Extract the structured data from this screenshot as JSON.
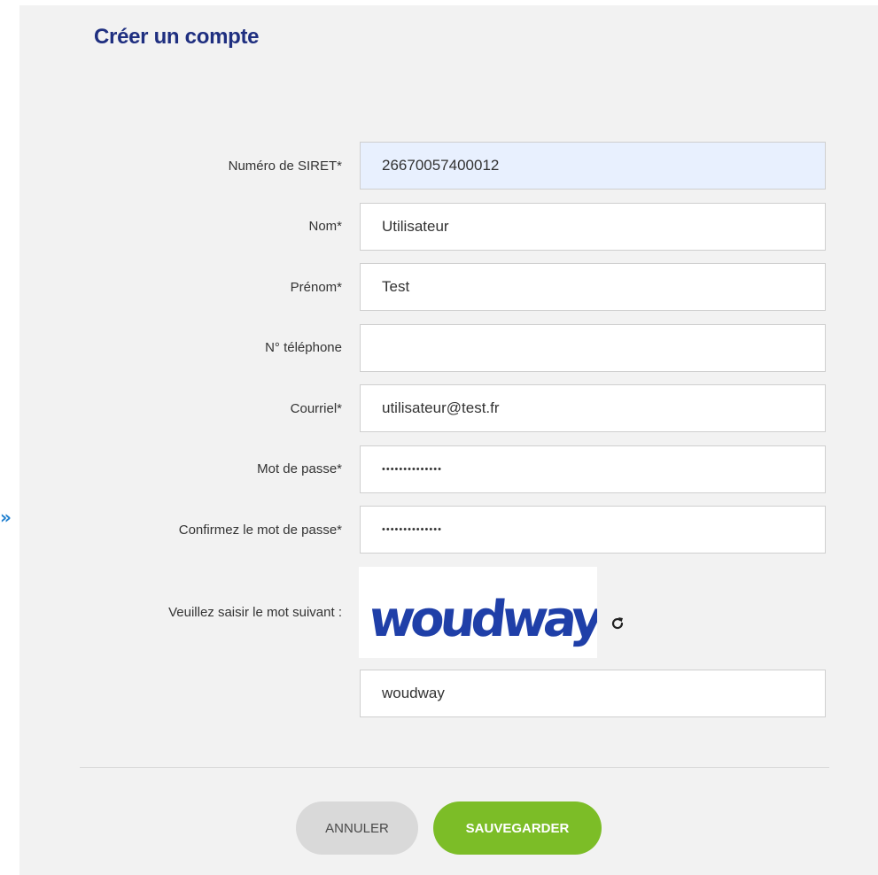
{
  "side_arrow": "»",
  "form": {
    "title": "Créer un compte",
    "fields": [
      {
        "label": "Numéro de SIRET*",
        "value": "26670057400012"
      },
      {
        "label": "Nom*",
        "value": "Utilisateur"
      },
      {
        "label": "Prénom*",
        "value": "Test"
      },
      {
        "label": "N° téléphone",
        "value": ""
      },
      {
        "label": "Courriel*",
        "value": "utilisateur@test.fr"
      },
      {
        "label": "Mot de passe*",
        "value": "••••••••••••••"
      },
      {
        "label": "Confirmez le mot de passe*",
        "value": "••••••••••••••"
      }
    ],
    "captcha": {
      "label": "Veuillez saisir le mot suivant :",
      "image_word": "woudway",
      "value": "woudway",
      "refresh_icon": "refresh-icon"
    },
    "buttons": {
      "cancel": "ANNULER",
      "save": "SAUVEGARDER"
    }
  },
  "colors": {
    "title": "#1f2f80",
    "save_button": "#7cbd27",
    "cancel_button": "#d9d9d9",
    "autofill_field": "#e8f0fe",
    "captcha_text": "#1f3fa8",
    "side_arrow": "#1f7fcf"
  }
}
